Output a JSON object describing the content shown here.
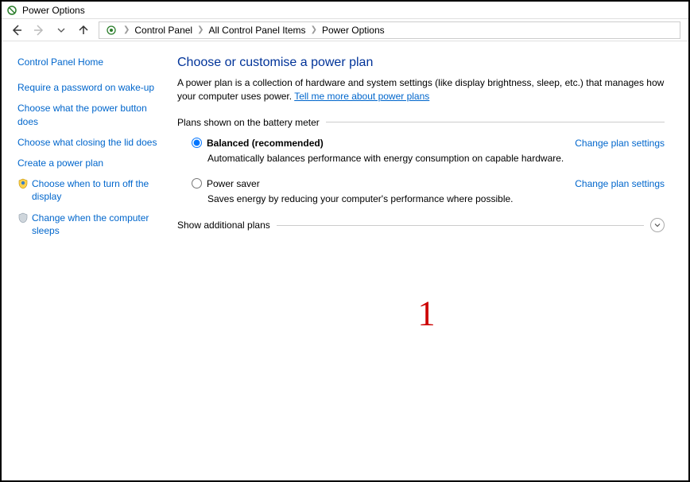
{
  "window": {
    "title": "Power Options"
  },
  "breadcrumbs": {
    "items": [
      "Control Panel",
      "All Control Panel Items",
      "Power Options"
    ]
  },
  "sidebar": {
    "home": "Control Panel Home",
    "links": [
      "Require a password on wake-up",
      "Choose what the power button does",
      "Choose what closing the lid does",
      "Create a power plan",
      "Choose when to turn off the display",
      "Change when the computer sleeps"
    ]
  },
  "main": {
    "heading": "Choose or customise a power plan",
    "description": "A power plan is a collection of hardware and system settings (like display brightness, sleep, etc.) that manages how your computer uses power. ",
    "description_link": "Tell me more about power plans",
    "section_title": "Plans shown on the battery meter",
    "plans": [
      {
        "name": "Balanced (recommended)",
        "desc": "Automatically balances performance with energy consumption on capable hardware.",
        "change": "Change plan settings",
        "selected": true
      },
      {
        "name": "Power saver",
        "desc": "Saves energy by reducing your computer's performance where possible.",
        "change": "Change plan settings",
        "selected": false
      }
    ],
    "additional": "Show additional plans"
  },
  "annotation": {
    "number": "1"
  }
}
